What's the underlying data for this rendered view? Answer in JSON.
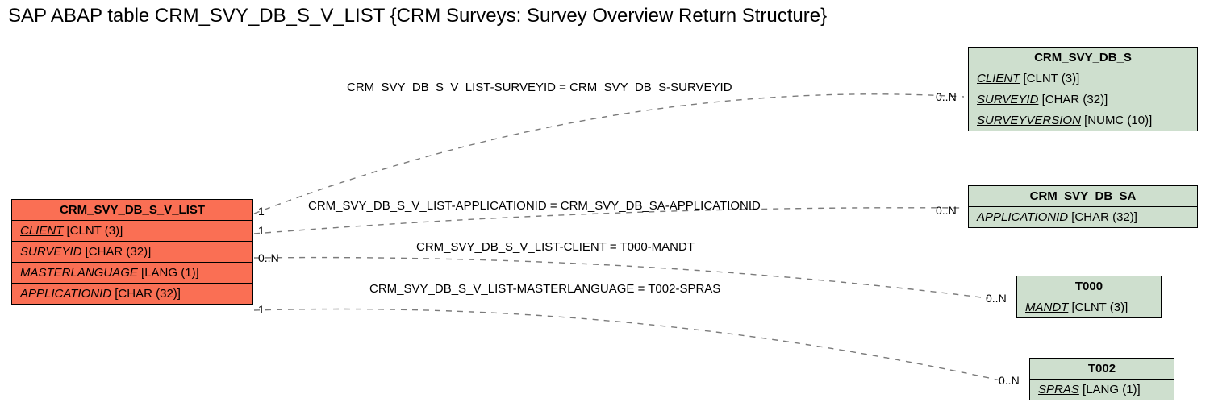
{
  "title": "SAP ABAP table CRM_SVY_DB_S_V_LIST {CRM Surveys: Survey Overview Return Structure}",
  "entities": {
    "main": {
      "name": "CRM_SVY_DB_S_V_LIST",
      "fields": [
        {
          "name": "CLIENT",
          "type": "[CLNT (3)]",
          "key": true
        },
        {
          "name": "SURVEYID",
          "type": "[CHAR (32)]",
          "key": false
        },
        {
          "name": "MASTERLANGUAGE",
          "type": "[LANG (1)]",
          "key": false
        },
        {
          "name": "APPLICATIONID",
          "type": "[CHAR (32)]",
          "key": false
        }
      ]
    },
    "e1": {
      "name": "CRM_SVY_DB_S",
      "fields": [
        {
          "name": "CLIENT",
          "type": "[CLNT (3)]",
          "key": true
        },
        {
          "name": "SURVEYID",
          "type": "[CHAR (32)]",
          "key": true
        },
        {
          "name": "SURVEYVERSION",
          "type": "[NUMC (10)]",
          "key": true
        }
      ]
    },
    "e2": {
      "name": "CRM_SVY_DB_SA",
      "fields": [
        {
          "name": "APPLICATIONID",
          "type": "[CHAR (32)]",
          "key": true
        }
      ]
    },
    "e3": {
      "name": "T000",
      "fields": [
        {
          "name": "MANDT",
          "type": "[CLNT (3)]",
          "key": true
        }
      ]
    },
    "e4": {
      "name": "T002",
      "fields": [
        {
          "name": "SPRAS",
          "type": "[LANG (1)]",
          "key": true
        }
      ]
    }
  },
  "relations": {
    "r1": {
      "label": "CRM_SVY_DB_S_V_LIST-SURVEYID = CRM_SVY_DB_S-SURVEYID",
      "leftCard": "1",
      "rightCard": "0..N"
    },
    "r2": {
      "label": "CRM_SVY_DB_S_V_LIST-APPLICATIONID = CRM_SVY_DB_SA-APPLICATIONID",
      "leftCard": "1",
      "rightCard": "0..N"
    },
    "r3": {
      "label": "CRM_SVY_DB_S_V_LIST-CLIENT = T000-MANDT",
      "leftCard": "0..N",
      "rightCard": "0..N"
    },
    "r4": {
      "label": "CRM_SVY_DB_S_V_LIST-MASTERLANGUAGE = T002-SPRAS",
      "leftCard": "1",
      "rightCard": "0..N"
    }
  },
  "chart_data": {
    "type": "table",
    "title": "SAP ABAP table CRM_SVY_DB_S_V_LIST {CRM Surveys: Survey Overview Return Structure}",
    "main_entity": {
      "name": "CRM_SVY_DB_S_V_LIST",
      "fields": [
        {
          "field": "CLIENT",
          "datatype": "CLNT",
          "length": 3,
          "key": true
        },
        {
          "field": "SURVEYID",
          "datatype": "CHAR",
          "length": 32,
          "key": false
        },
        {
          "field": "MASTERLANGUAGE",
          "datatype": "LANG",
          "length": 1,
          "key": false
        },
        {
          "field": "APPLICATIONID",
          "datatype": "CHAR",
          "length": 32,
          "key": false
        }
      ]
    },
    "related_entities": [
      {
        "name": "CRM_SVY_DB_S",
        "fields": [
          {
            "field": "CLIENT",
            "datatype": "CLNT",
            "length": 3,
            "key": true
          },
          {
            "field": "SURVEYID",
            "datatype": "CHAR",
            "length": 32,
            "key": true
          },
          {
            "field": "SURVEYVERSION",
            "datatype": "NUMC",
            "length": 10,
            "key": true
          }
        ]
      },
      {
        "name": "CRM_SVY_DB_SA",
        "fields": [
          {
            "field": "APPLICATIONID",
            "datatype": "CHAR",
            "length": 32,
            "key": true
          }
        ]
      },
      {
        "name": "T000",
        "fields": [
          {
            "field": "MANDT",
            "datatype": "CLNT",
            "length": 3,
            "key": true
          }
        ]
      },
      {
        "name": "T002",
        "fields": [
          {
            "field": "SPRAS",
            "datatype": "LANG",
            "length": 1,
            "key": true
          }
        ]
      }
    ],
    "relationships": [
      {
        "from": "CRM_SVY_DB_S_V_LIST.SURVEYID",
        "to": "CRM_SVY_DB_S.SURVEYID",
        "from_card": "1",
        "to_card": "0..N"
      },
      {
        "from": "CRM_SVY_DB_S_V_LIST.APPLICATIONID",
        "to": "CRM_SVY_DB_SA.APPLICATIONID",
        "from_card": "1",
        "to_card": "0..N"
      },
      {
        "from": "CRM_SVY_DB_S_V_LIST.CLIENT",
        "to": "T000.MANDT",
        "from_card": "0..N",
        "to_card": "0..N"
      },
      {
        "from": "CRM_SVY_DB_S_V_LIST.MASTERLANGUAGE",
        "to": "T002.SPRAS",
        "from_card": "1",
        "to_card": "0..N"
      }
    ]
  }
}
